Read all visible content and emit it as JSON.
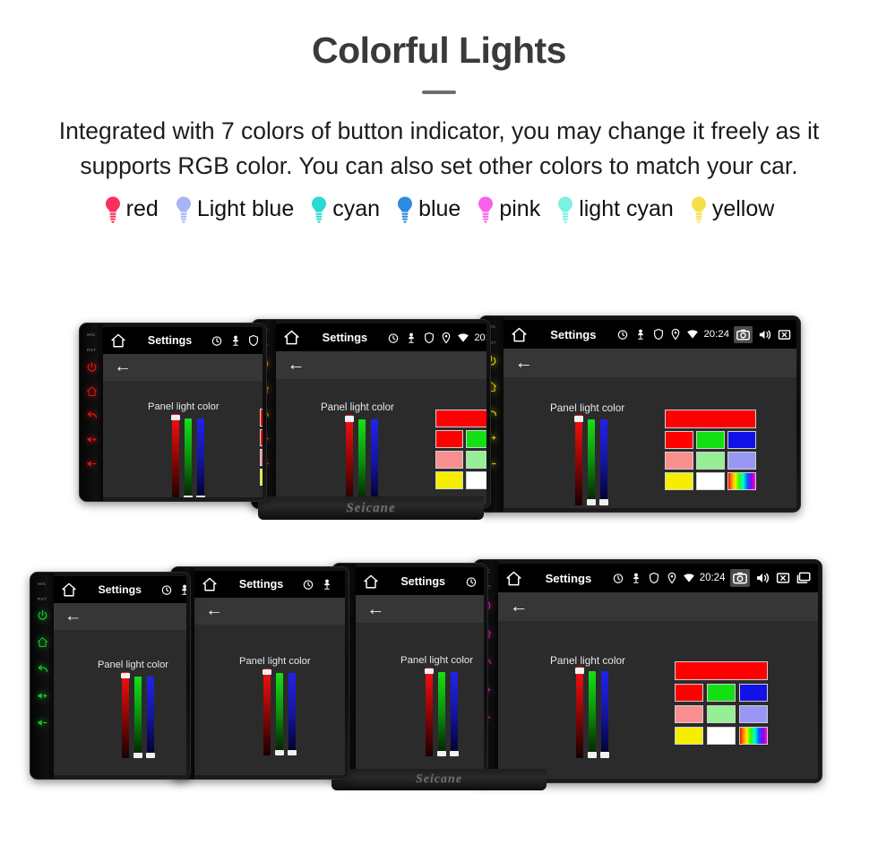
{
  "header": {
    "title": "Colorful Lights",
    "subtitle": "Integrated with 7 colors of button indicator, you may change it freely as it supports RGB color. You can also set other colors to match your car."
  },
  "legend": {
    "items": [
      {
        "label": "red",
        "color": "#f8315e",
        "icon": "bulb-icon"
      },
      {
        "label": "Light blue",
        "color": "#a8b4f5",
        "icon": "bulb-icon"
      },
      {
        "label": "cyan",
        "color": "#2ad9cf",
        "icon": "bulb-icon"
      },
      {
        "label": "blue",
        "color": "#2f8be0",
        "icon": "bulb-icon"
      },
      {
        "label": "pink",
        "color": "#f862ea",
        "icon": "bulb-icon"
      },
      {
        "label": "light cyan",
        "color": "#7ef0e0",
        "icon": "bulb-icon"
      },
      {
        "label": "yellow",
        "color": "#f5e04a",
        "icon": "bulb-icon"
      }
    ]
  },
  "screen_ui": {
    "app_title": "Settings",
    "time": "20:24",
    "panel_label": "Panel light color",
    "home_icon": "home-icon",
    "back_icon": "back-arrow-icon",
    "clock_icon": "clock-icon",
    "person_icon": "person-icon",
    "shield_icon": "shield-icon",
    "location_icon": "location-icon",
    "wifi_icon": "wifi-icon",
    "camera_icon": "camera-icon",
    "volume_icon": "volume-icon",
    "close_icon": "close-box-icon",
    "recents_icon": "recents-icon",
    "return_icon": "return-arrow-icon",
    "sliders": [
      {
        "name": "red-slider",
        "value": 100,
        "thumb_position": "top"
      },
      {
        "name": "green-slider",
        "value": 0,
        "thumb_position": "bottom"
      },
      {
        "name": "blue-slider",
        "value": 0,
        "thumb_position": "bottom"
      }
    ],
    "preview_color": "#ff0000",
    "palette": [
      [
        "#ff0000",
        "#12e012",
        "#1212e8"
      ],
      [
        "#f98e8e",
        "#96ee96",
        "#9898f4"
      ],
      [
        "#f5ee00",
        "#ffffff",
        "rainbow"
      ]
    ]
  },
  "brand": {
    "name": "Seicane"
  },
  "devices": {
    "bezel_labels": {
      "mic": "MIC",
      "rst": "RST"
    },
    "bezel_buttons": [
      "power-icon",
      "home-icon",
      "back-icon",
      "volume-up-icon",
      "volume-down-icon"
    ],
    "top_row": [
      {
        "name": "device-red",
        "led_color": "#e01515"
      },
      {
        "name": "device-orange",
        "led_color": "#e8930c"
      },
      {
        "name": "device-yellow",
        "led_color": "#f2e008"
      }
    ],
    "bottom_row": [
      {
        "name": "device-green",
        "led_color": "#17cc2a"
      },
      {
        "name": "device-cyan",
        "led_color": "#14d8d8"
      },
      {
        "name": "device-blue",
        "led_color": "#2020f0"
      },
      {
        "name": "device-magenta",
        "led_color": "#ef20c8"
      }
    ]
  }
}
